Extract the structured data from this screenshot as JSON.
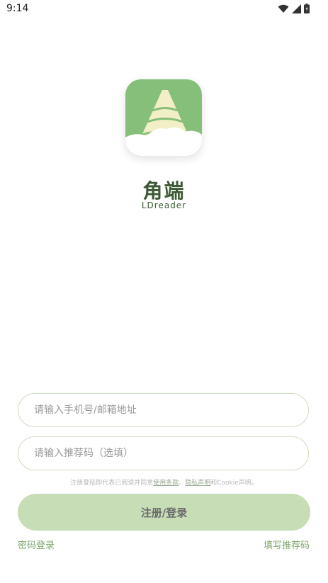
{
  "status": {
    "time": "9:14"
  },
  "app": {
    "name": "角端",
    "subtitle": "LDreader"
  },
  "form": {
    "phone_placeholder": "请输入手机号/邮箱地址",
    "referral_placeholder": "请输入推荐码（选填）"
  },
  "agreement": {
    "prefix": "注册登陆即代表已阅读并同意",
    "terms": "使用条款",
    "sep": "、",
    "privacy": "隐私声明",
    "suffix": "和Cookie声明。"
  },
  "actions": {
    "submit_label": "注册/登录",
    "password_login": "密码登录",
    "referral_code": "填写推荐码"
  },
  "colors": {
    "accent": "#7fb070",
    "button": "#c7ddb6",
    "brand_text": "#3b5a33"
  }
}
